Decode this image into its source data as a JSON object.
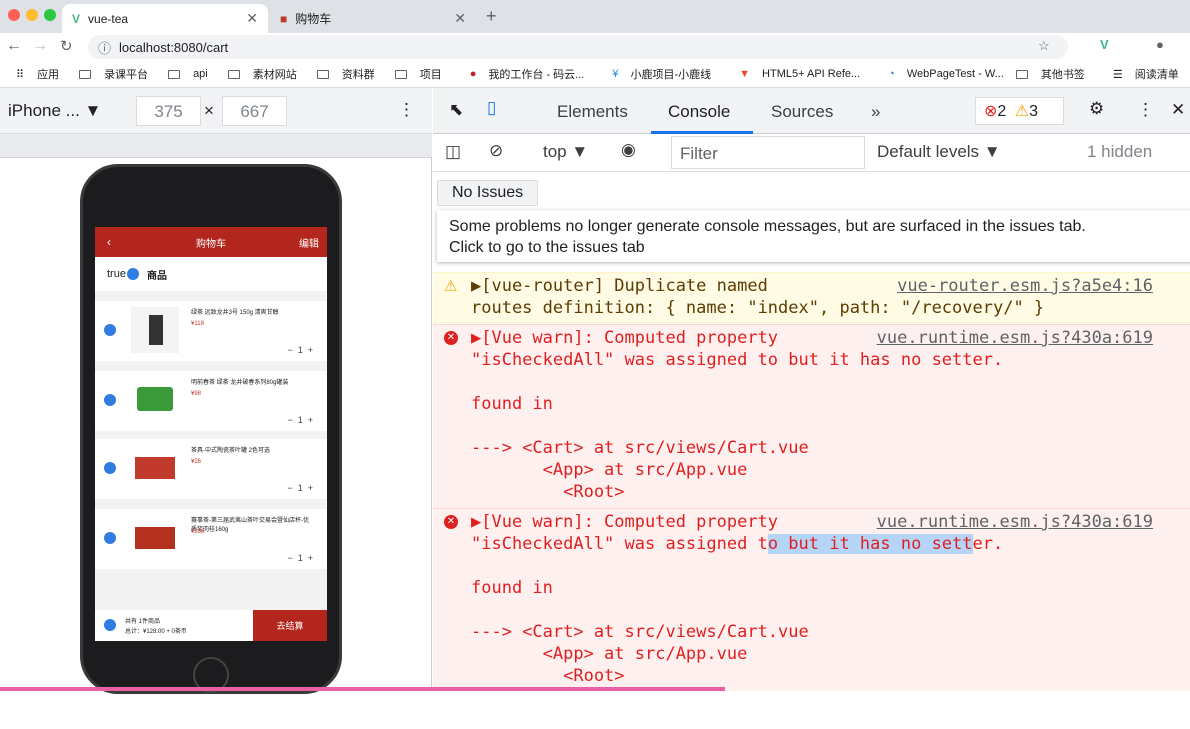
{
  "browser": {
    "tabs": [
      {
        "title": "vue-tea",
        "icon": "vue-logo-icon"
      },
      {
        "title": "购物车",
        "icon": "cart-favicon-icon"
      }
    ],
    "url": "localhost:8080/cart",
    "bookmarks": [
      "应用",
      "录课平台",
      "api",
      "素材网站",
      "资料群",
      "项目",
      "我的工作台 - 码云...",
      "小鹿项目-小鹿线",
      "HTML5+ API Refe...",
      "WebPageTest - W...",
      "其他书签",
      "阅读清单"
    ]
  },
  "device": {
    "name": "iPhone ...",
    "width": "375",
    "height": "667",
    "x": "×"
  },
  "app": {
    "header_title": "购物车",
    "back": "‹",
    "edit": "编辑",
    "store_label": "true",
    "store_name": "商品",
    "items": [
      {
        "name": "绿茶 远致龙井3号 150g 清爽甘醇",
        "price": "¥118",
        "qty": "1"
      },
      {
        "name": "明前春茶 绿茶 龙井破春系列80g罐装",
        "price": "¥98",
        "qty": "1"
      },
      {
        "name": "茶具-中式陶瓷茶叶罐 2色可选",
        "price": "¥26",
        "qty": "1"
      },
      {
        "name": "赛事茶-第三届武夷山茶叶交易会暨仙店杯-优质奖肉桂160g",
        "price": "¥238",
        "qty": "1"
      }
    ],
    "footer_count": "共有 1件商品",
    "footer_total": "总计：¥128.00 + 0茶币",
    "checkout": "去结算"
  },
  "devtools": {
    "tabs": [
      "Elements",
      "Console",
      "Sources",
      "»"
    ],
    "errors": "2",
    "warnings": "3",
    "context": "top ▼",
    "filter_placeholder": "Filter",
    "levels": "Default levels ▼",
    "hidden": "1 hidden",
    "no_issues": "No Issues",
    "tooltip_line1": "Some problems no longer generate console messages, but are surfaced in the issues tab.",
    "tooltip_line2": "Click to go to the issues tab",
    "warn_line1": "▶[vue-router] Duplicate named",
    "warn_line2": "routes definition: { name: \"index\", path: \"/recovery/\" }",
    "warn_src": "vue-router.esm.js?a5e4:16",
    "err_line1": "▶[Vue warn]: Computed property",
    "err_line2": "\"isCheckedAll\" was assigned to but it has no setter.",
    "err_line2_pre": "\"isCheckedAll\" was assigned t",
    "err_line2_hl": "o but it has no sett",
    "err_line2_post": "er.",
    "err_found": "found in",
    "err_trace1": "---> <Cart> at src/views/Cart.vue",
    "err_trace2": "       <App> at src/App.vue",
    "err_trace3": "         <Root>",
    "err_src": "vue.runtime.esm.js?430a:619"
  }
}
